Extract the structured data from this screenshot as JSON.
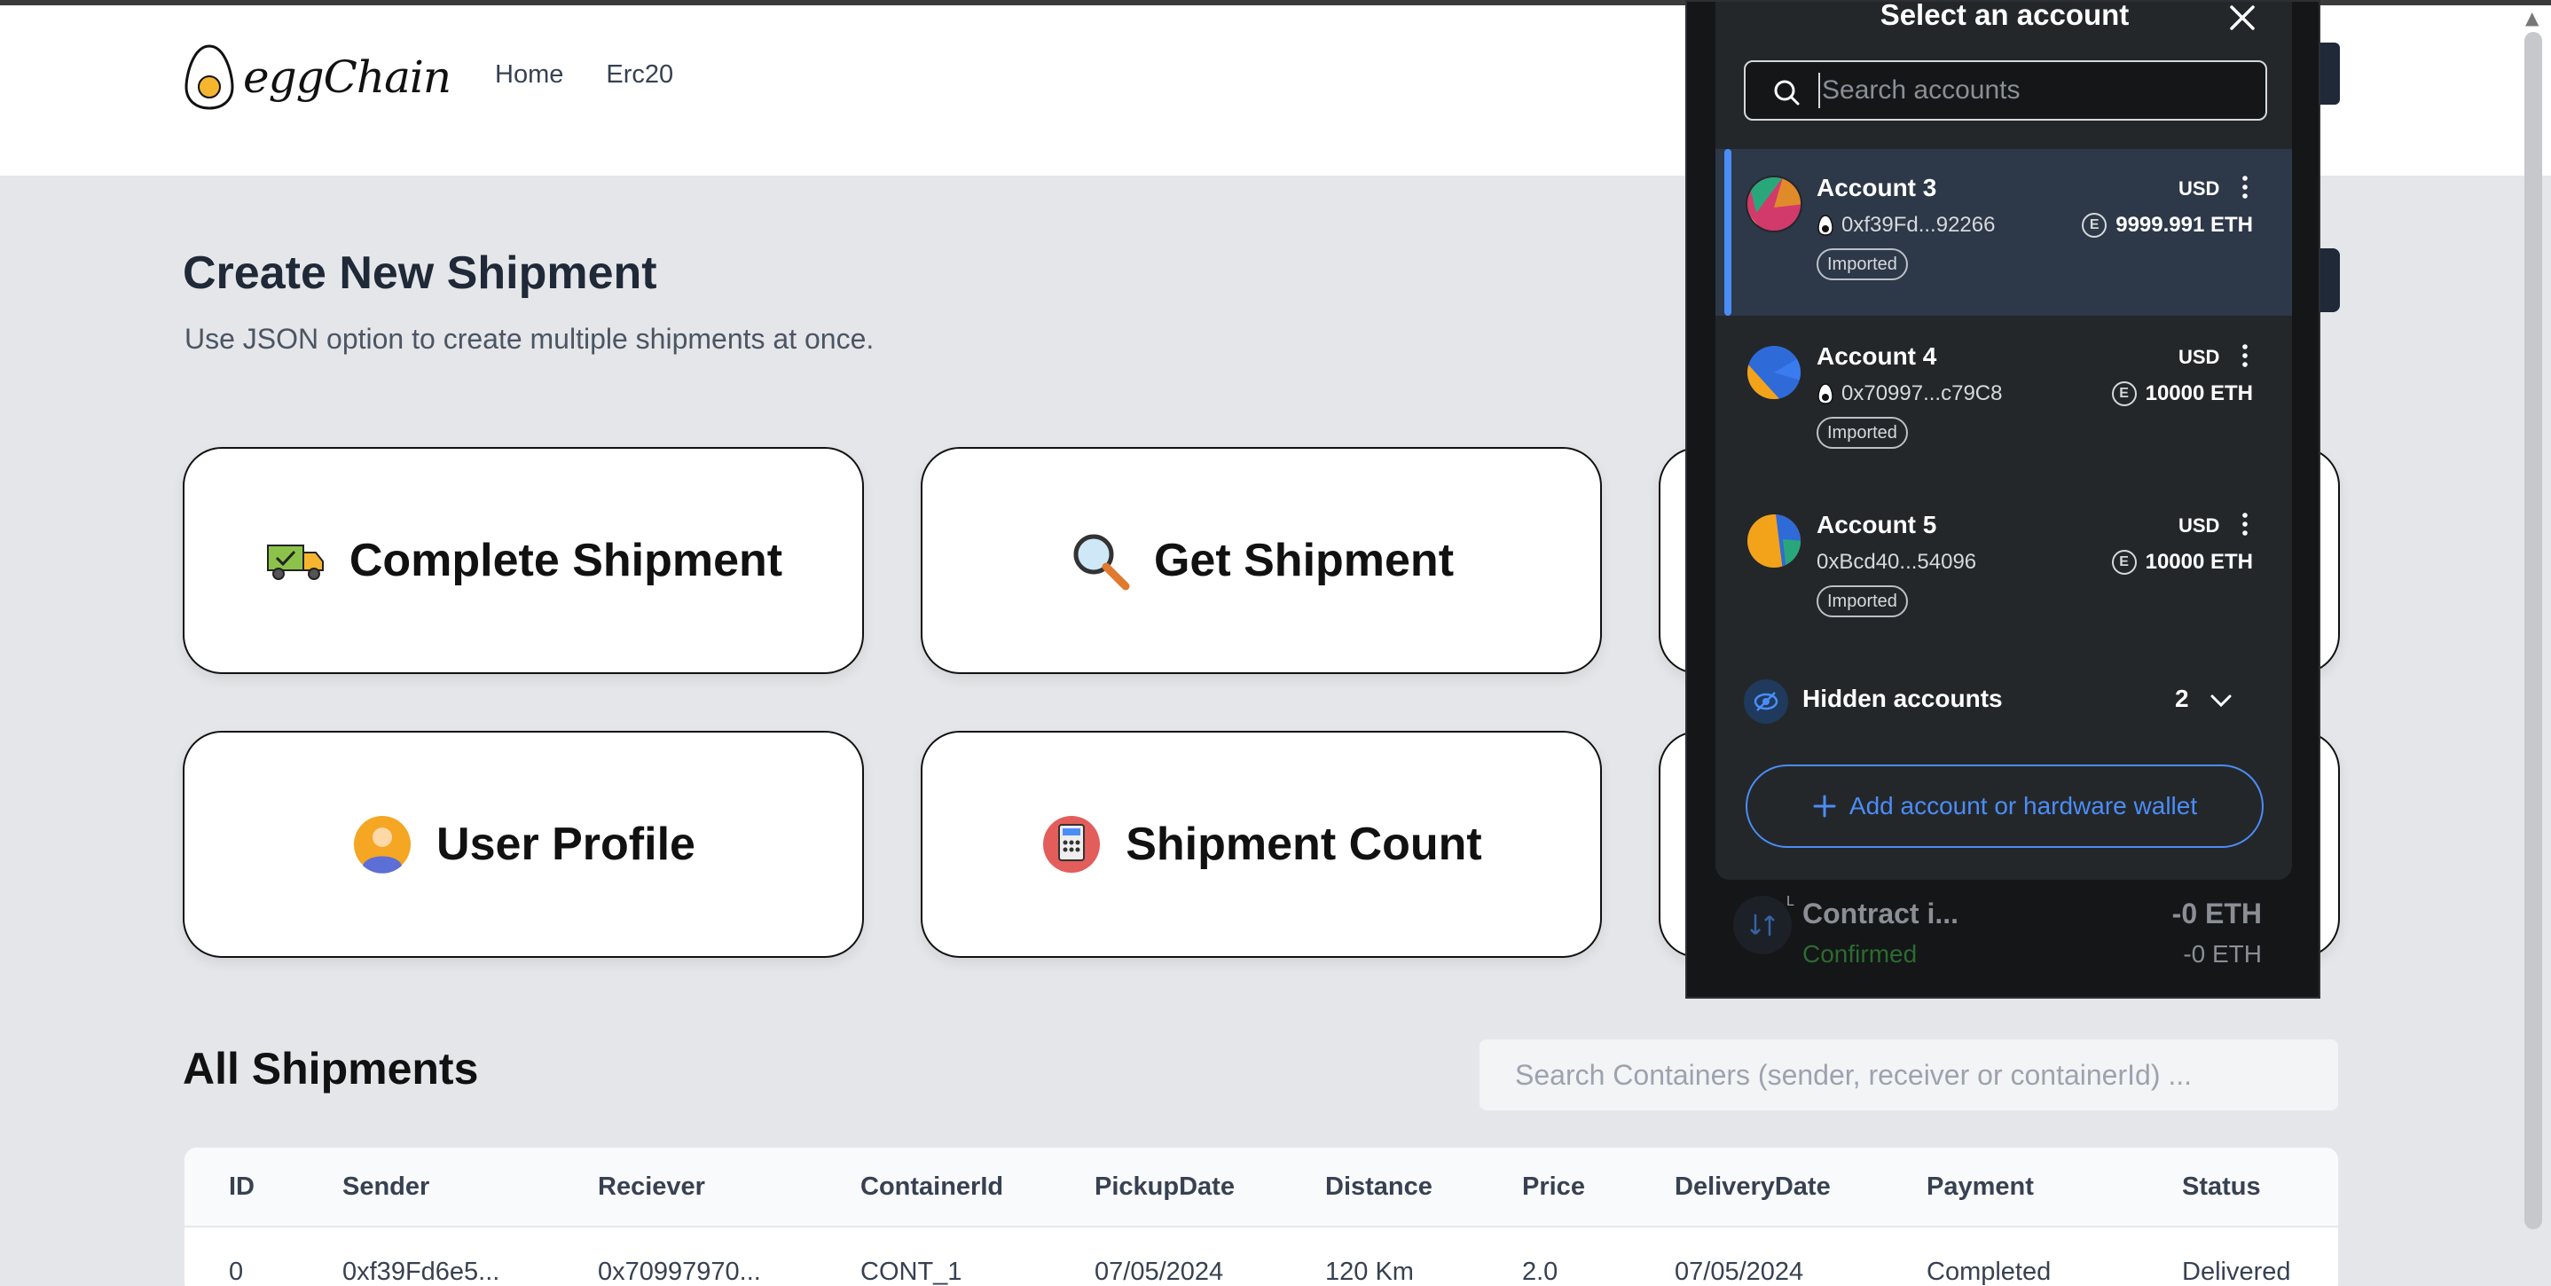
{
  "app": {
    "logo_text": "eggChain",
    "nav": {
      "home": "Home",
      "erc20": "Erc20"
    }
  },
  "hero": {
    "title": "Create New Shipment",
    "subtitle": "Use JSON option to create multiple shipments at once."
  },
  "cards": [
    {
      "label": "Complete Shipment",
      "icon": "delivery-truck-icon"
    },
    {
      "label": "Get Shipment",
      "icon": "magnifying-glass-icon"
    },
    {
      "label": "User Profile",
      "icon": "user-avatar-icon"
    },
    {
      "label": "Shipment Count",
      "icon": "calculator-icon"
    }
  ],
  "shipments": {
    "title": "All Shipments",
    "search_placeholder": "Search Containers (sender, receiver or containerId) ...",
    "columns": [
      "ID",
      "Sender",
      "Reciever",
      "ContainerId",
      "PickupDate",
      "Distance",
      "Price",
      "DeliveryDate",
      "Payment",
      "Status"
    ],
    "rows": [
      [
        "0",
        "0xf39Fd6e5...",
        "0x70997970...",
        "CONT_1",
        "07/05/2024",
        "120 Km",
        "2.0",
        "07/05/2024",
        "Completed",
        "Delivered"
      ]
    ]
  },
  "wallet": {
    "title": "Select an account",
    "search_placeholder": "Search accounts",
    "accounts": [
      {
        "name": "Account 3",
        "currency": "USD",
        "address": "0xf39Fd...92266",
        "balance": "9999.991 ETH",
        "tag": "Imported",
        "selected": true
      },
      {
        "name": "Account 4",
        "currency": "USD",
        "address": "0x70997...c79C8",
        "balance": "10000 ETH",
        "tag": "Imported",
        "selected": false
      },
      {
        "name": "Account 5",
        "currency": "USD",
        "address": "0xBcd40...54096",
        "balance": "10000 ETH",
        "tag": "Imported",
        "selected": false
      }
    ],
    "hidden": {
      "label": "Hidden accounts",
      "count": "2"
    },
    "add_button": "Add account or hardware wallet",
    "activity": {
      "title": "Contract i...",
      "status": "Confirmed",
      "amount": "-0 ETH",
      "amount_secondary": "-0 ETH",
      "badge": "L"
    },
    "colors": {
      "accent": "#4b8df8",
      "panel": "#24272a",
      "selected": "#2d3848"
    }
  }
}
